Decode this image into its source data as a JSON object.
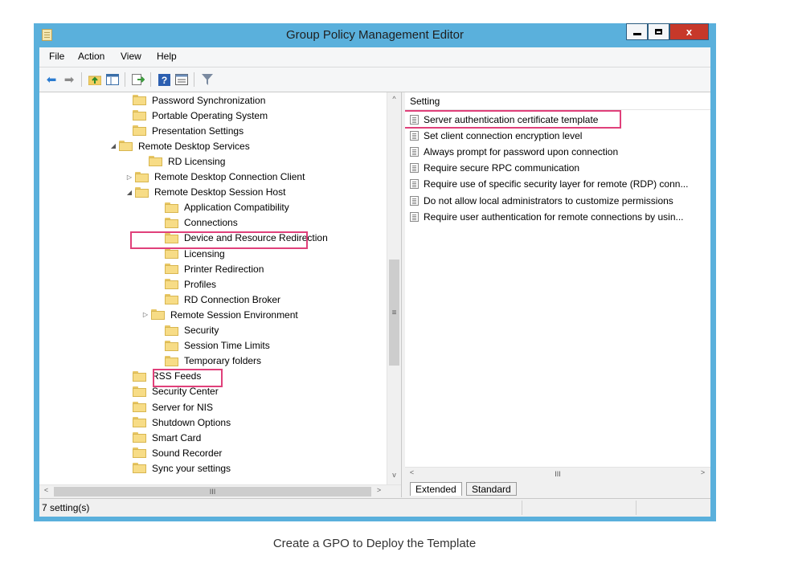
{
  "window": {
    "title": "Group Policy Management Editor",
    "close_label": "x"
  },
  "menu": [
    "File",
    "Action",
    "View",
    "Help"
  ],
  "toolbar_icons": [
    "back-arrow-icon",
    "forward-arrow-icon",
    "up-folder-icon",
    "show-hide-tree-icon",
    "export-list-icon",
    "help-icon",
    "properties-icon",
    "filter-icon"
  ],
  "tree": {
    "items": [
      {
        "label": "Password Synchronization",
        "expander": ""
      },
      {
        "label": "Portable Operating System",
        "expander": ""
      },
      {
        "label": "Presentation Settings",
        "expander": ""
      },
      {
        "label": "Remote Desktop Services",
        "expander": "◢"
      },
      {
        "label": "RD Licensing",
        "expander": ""
      },
      {
        "label": "Remote Desktop Connection Client",
        "expander": "▷"
      },
      {
        "label": "Remote Desktop Session Host",
        "expander": "◢"
      },
      {
        "label": "Application Compatibility",
        "expander": ""
      },
      {
        "label": "Connections",
        "expander": ""
      },
      {
        "label": "Device and Resource Redirection",
        "expander": ""
      },
      {
        "label": "Licensing",
        "expander": ""
      },
      {
        "label": "Printer Redirection",
        "expander": ""
      },
      {
        "label": "Profiles",
        "expander": ""
      },
      {
        "label": "RD Connection Broker",
        "expander": ""
      },
      {
        "label": "Remote Session Environment",
        "expander": "▷"
      },
      {
        "label": "Security",
        "expander": ""
      },
      {
        "label": "Session Time Limits",
        "expander": ""
      },
      {
        "label": "Temporary folders",
        "expander": ""
      },
      {
        "label": "RSS Feeds",
        "expander": ""
      },
      {
        "label": "Security Center",
        "expander": ""
      },
      {
        "label": "Server for NIS",
        "expander": ""
      },
      {
        "label": "Shutdown Options",
        "expander": ""
      },
      {
        "label": "Smart Card",
        "expander": ""
      },
      {
        "label": "Sound Recorder",
        "expander": ""
      },
      {
        "label": "Sync your settings",
        "expander": ""
      }
    ]
  },
  "scroll": {
    "up": "^",
    "down": "v",
    "left": "<",
    "right": ">",
    "vgrip": "≡",
    "hgrip": "III"
  },
  "settings": {
    "column_header": "Setting",
    "items": [
      "Server authentication certificate template",
      "Set client connection encryption level",
      "Always prompt for password upon connection",
      "Require secure RPC communication",
      "Require use of specific security layer for remote (RDP) conn...",
      "Do not allow local administrators to customize permissions",
      "Require user authentication for remote connections by usin..."
    ]
  },
  "tabs": {
    "extended": "Extended",
    "standard": "Standard"
  },
  "status": {
    "text": "7 setting(s)"
  },
  "caption": "Create a GPO to Deploy the Template",
  "colors": {
    "highlight": "#e0407a",
    "window_frame": "#5ab0dc",
    "close_button": "#c7382a"
  }
}
